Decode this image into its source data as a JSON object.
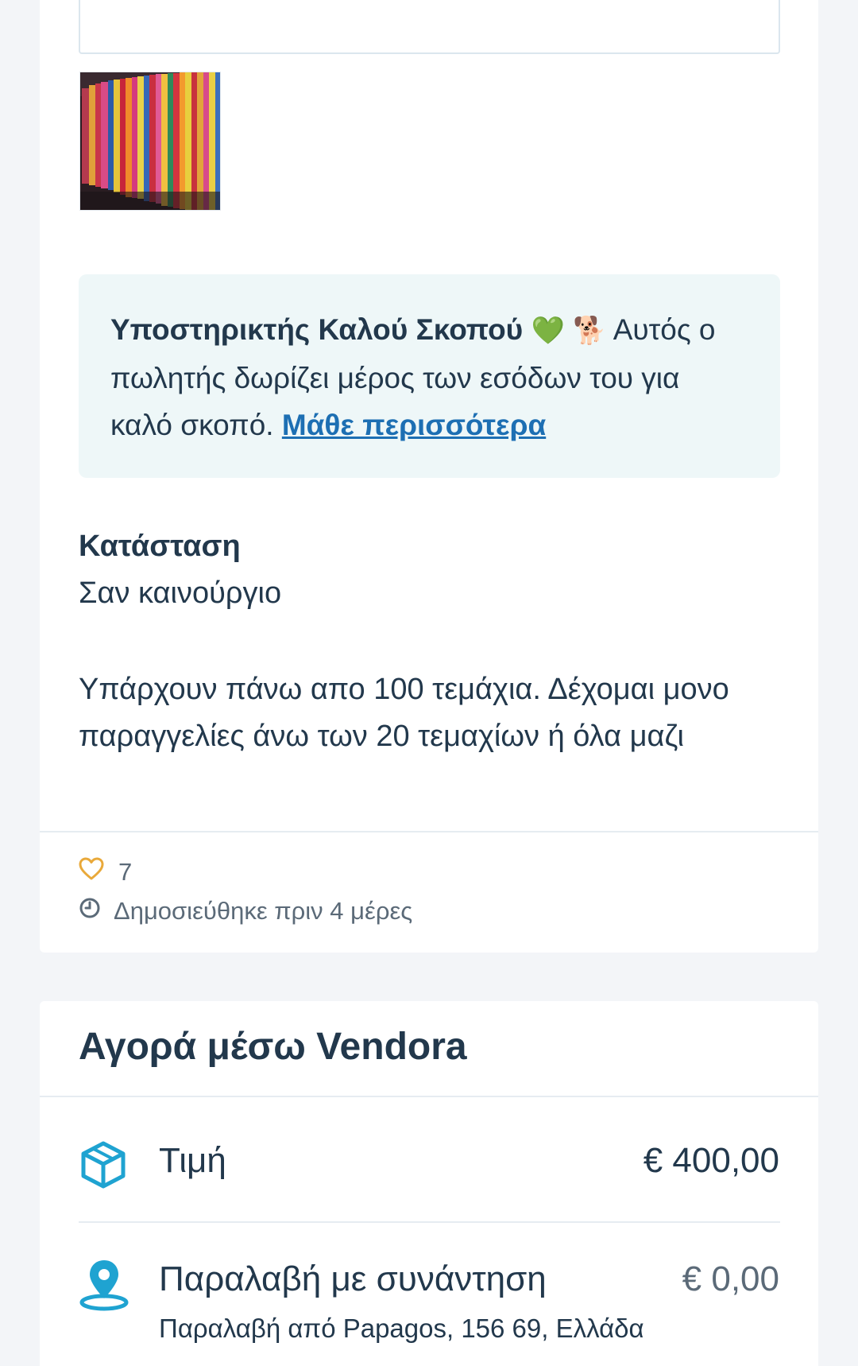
{
  "listing": {
    "image_alt": "comic books on a shelf",
    "charity": {
      "title": "Υποστηρικτής Καλού Σκοπού",
      "emoji_heart": "💚",
      "emoji_dog": "🐕",
      "text": "Αυτός ο πωλητής δωρίζει μέρος των εσόδων του για καλό σκοπό.",
      "link_label": "Μάθε περισσότερα"
    },
    "condition": {
      "label": "Κατάσταση",
      "value": "Σαν καινούργιο"
    },
    "description": "Υπάρχουν πάνω απο 100 τεμάχια. Δέχομαι μονο παραγγελίες άνω των 20 τεμαχίων ή όλα μαζι",
    "likes": "7",
    "posted": "Δημοσιεύθηκε πριν 4 μέρες"
  },
  "purchase": {
    "title": "Αγορά μέσω Vendora",
    "price_label": "Τιμή",
    "price_value": "€ 400,00",
    "pickup_label": "Παραλαβή με συνάντηση",
    "pickup_value": "€ 0,00",
    "pickup_address": "Παραλαβή από Papagos, 156 69, Ελλάδα"
  },
  "icons": {
    "heart": "heart-icon",
    "clock": "clock-icon",
    "box": "package-icon",
    "location": "location-pin-icon"
  },
  "colors": {
    "accent": "#1d6fb3",
    "icon_teal": "#1fa3d1",
    "heart_orange": "#e9a93a",
    "charity_bg": "#eef7f8",
    "text": "#22384c"
  }
}
